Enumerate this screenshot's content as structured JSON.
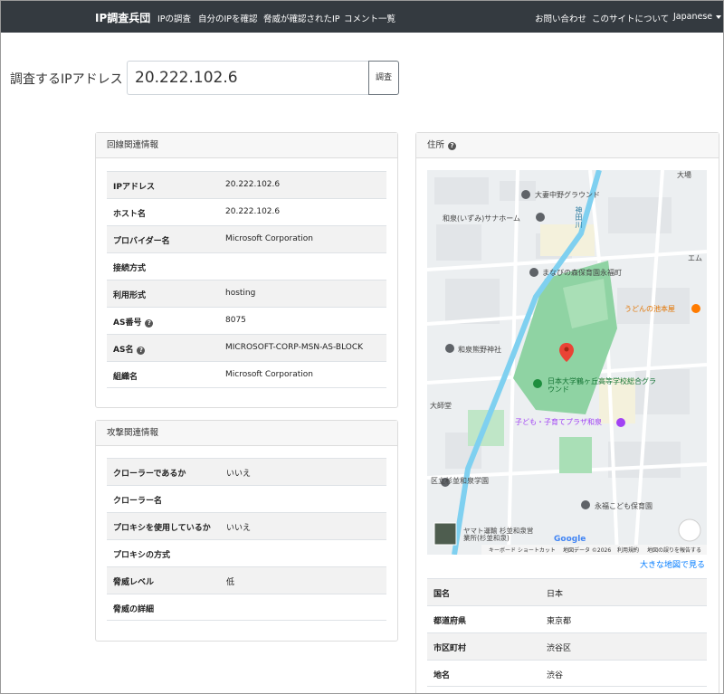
{
  "navbar": {
    "brand": "IP調査兵団",
    "links": [
      "IPの調査",
      "自分のIPを確認",
      "脅威が確認されたIP",
      "コメント一覧"
    ],
    "right_links": [
      "お問い合わせ",
      "このサイトについて"
    ],
    "language": "Japanese"
  },
  "search": {
    "label": "調査するIPアドレス",
    "value": "20.222.102.6",
    "button": "調査"
  },
  "line_info": {
    "header": "回線関連情報",
    "rows": [
      {
        "key": "IPアドレス",
        "value": "20.222.102.6"
      },
      {
        "key": "ホスト名",
        "value": "20.222.102.6"
      },
      {
        "key": "プロバイダー名",
        "value": "Microsoft Corporation"
      },
      {
        "key": "接続方式",
        "value": ""
      },
      {
        "key": "利用形式",
        "value": "hosting"
      },
      {
        "key": "AS番号",
        "value": "8075"
      },
      {
        "key": "AS名",
        "value": "MICROSOFT-CORP-MSN-AS-BLOCK"
      },
      {
        "key": "組織名",
        "value": "Microsoft Corporation"
      }
    ]
  },
  "attack_info": {
    "header": "攻撃関連情報",
    "rows": [
      {
        "key": "クローラーであるか",
        "value": "いいえ"
      },
      {
        "key": "クローラー名",
        "value": ""
      },
      {
        "key": "プロキシを使用しているか",
        "value": "いいえ"
      },
      {
        "key": "プロキシの方式",
        "value": ""
      },
      {
        "key": "脅威レベル",
        "value": "低"
      },
      {
        "key": "脅威の詳細",
        "value": ""
      }
    ]
  },
  "address": {
    "header": "住所",
    "map_link": "大きな地図で見る",
    "rows": [
      {
        "key": "国名",
        "value": "日本"
      },
      {
        "key": "都道府県",
        "value": "東京都"
      },
      {
        "key": "市区町村",
        "value": "渋谷区"
      },
      {
        "key": "地名",
        "value": "渋谷"
      }
    ]
  },
  "map": {
    "labels": {
      "taisho": "大妻中野グラウンド",
      "izumi": "和泉(いずみ)サナホーム",
      "manabi": "まなびの森保育園永福町",
      "udon": "うどんの池本屋",
      "kumano": "和泉熊野神社",
      "nihon": "日本大学鶴ヶ丘高等学校総合グラウンド",
      "kodomo": "子ども・子育てプラザ和泉",
      "daishido": "大師堂",
      "izumi_school": "区立杉並和泉学園",
      "eifuku": "永福こども保育園",
      "yamato": "ヤマト運輸 杉並和泉営業所(杉並和泉)",
      "river": "神田川",
      "emu": "エム",
      "okuma": "大場"
    },
    "google": "Google",
    "footer": [
      "キーボード ショートカット",
      "地図データ ©2026",
      "利用規約",
      "地図の誤りを報告する"
    ]
  },
  "colors": {
    "navbar": "#343a40",
    "link": "#007bff",
    "park": "#8fd3a3",
    "river": "#7fd0f0",
    "marker": "#ea4335"
  }
}
